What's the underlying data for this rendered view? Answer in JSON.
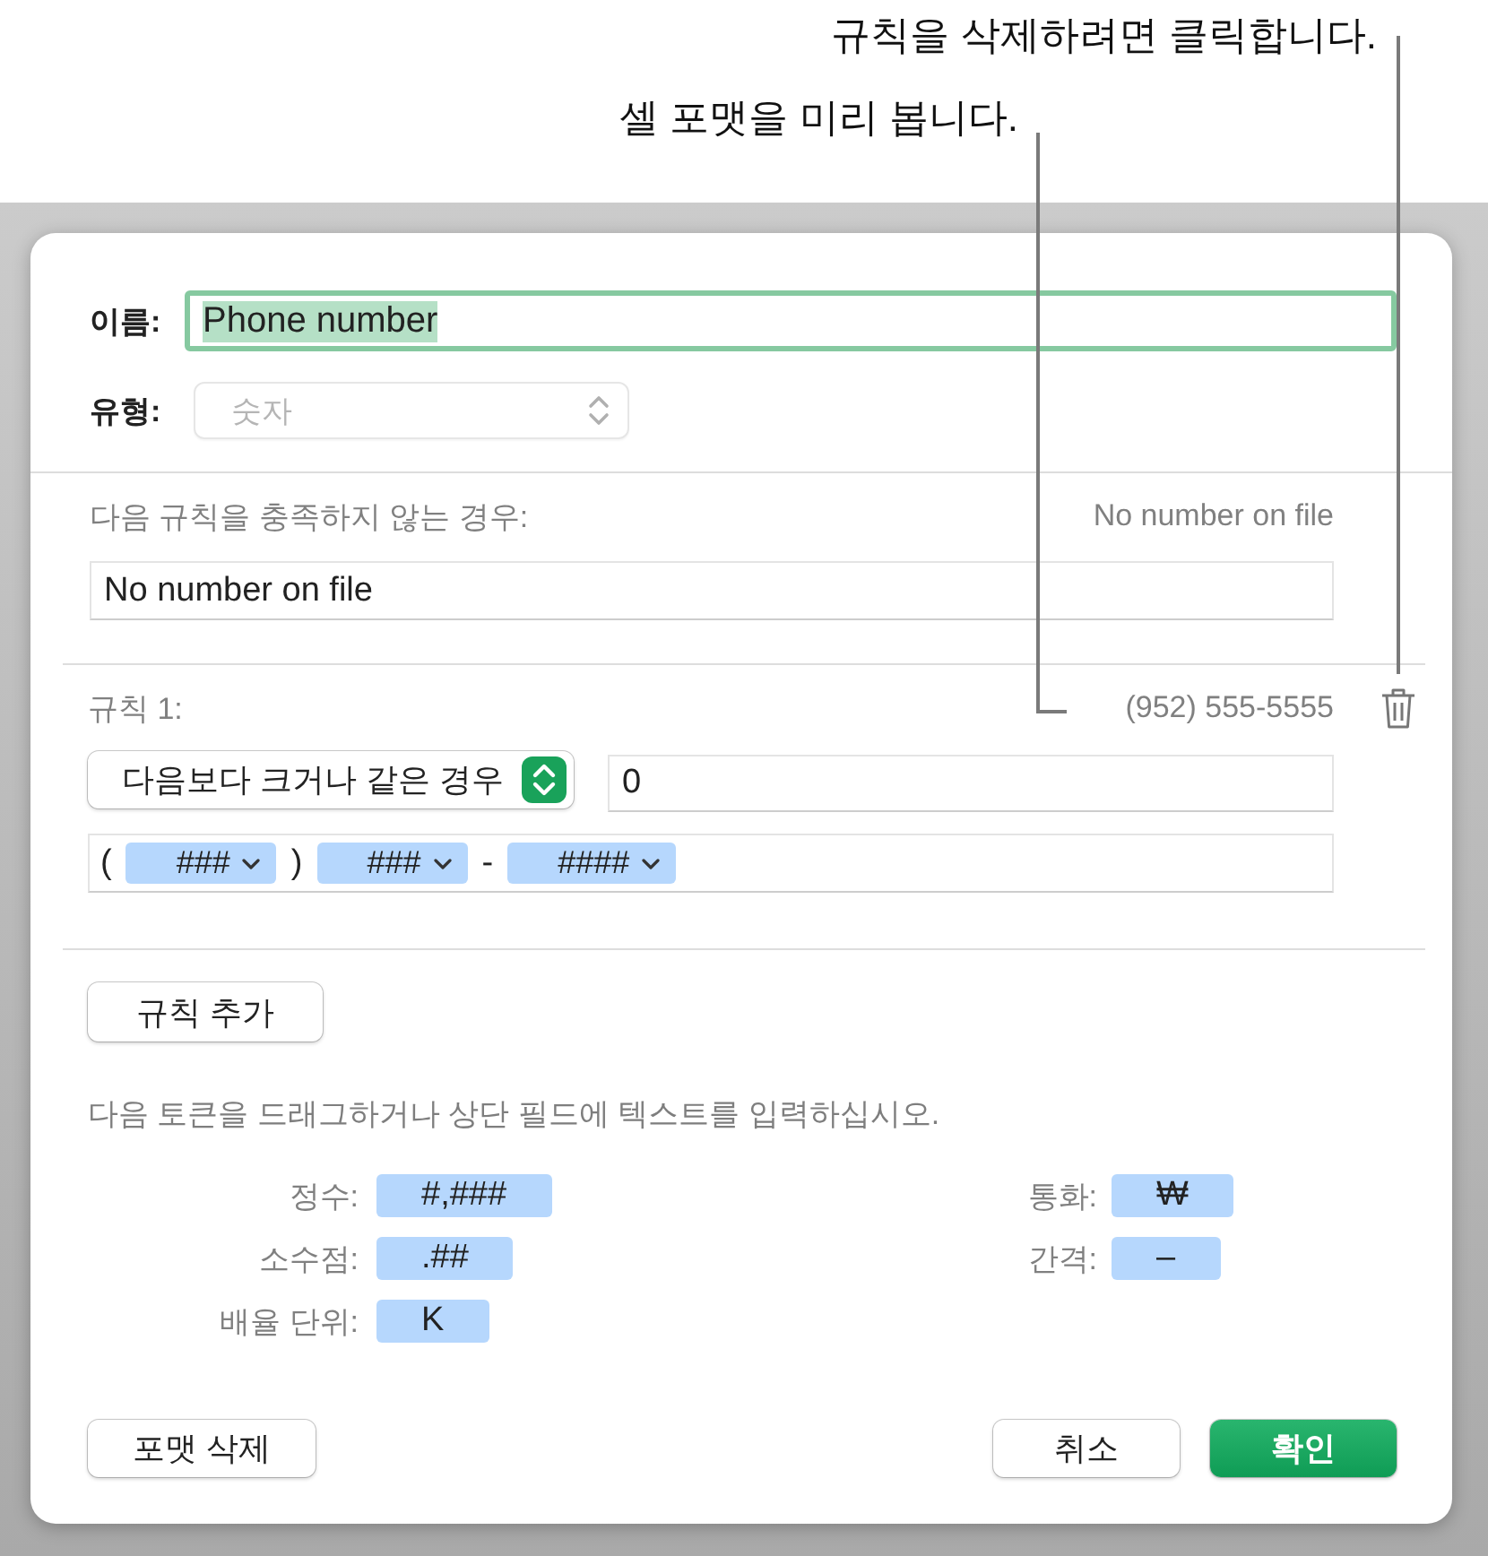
{
  "callouts": [
    {
      "text": "규칙을 삭제하려면 클릭합니다."
    },
    {
      "text": "셀 포맷을 미리 봅니다."
    }
  ],
  "name": {
    "label": "이름:",
    "value": "Phone number",
    "focused": true,
    "text_selected": true
  },
  "type": {
    "label": "유형:",
    "value": "숫자",
    "disabled": true
  },
  "fallback": {
    "label": "다음 규칙을 충족하지 않는 경우:",
    "preview": "No number on file",
    "value": "No number on file"
  },
  "rules": [
    {
      "label": "규칙 1:",
      "preview": "(952) 555-5555",
      "condition": "다음보다 크거나 같은 경우",
      "threshold": "0",
      "format": [
        {
          "kind": "text",
          "text": "("
        },
        {
          "kind": "token",
          "text": "###"
        },
        {
          "kind": "text",
          "text": ")"
        },
        {
          "kind": "token",
          "text": "###"
        },
        {
          "kind": "text",
          "text": "-"
        },
        {
          "kind": "token",
          "text": "####"
        }
      ]
    }
  ],
  "add_rule_button": "규칙 추가",
  "instructions": "다음 토큰을 드래그하거나 상단 필드에 텍스트를 입력하십시오.",
  "token_groups": [
    [
      {
        "label": "정수:",
        "token": "#,###"
      },
      {
        "label": "소수점:",
        "token": ".##"
      },
      {
        "label": "배율 단위:",
        "token": "K"
      }
    ],
    [
      {
        "label": "통화:",
        "token": "₩"
      },
      {
        "label": "간격:",
        "token": "–"
      }
    ]
  ],
  "footer": {
    "left": [
      {
        "label": "포맷 삭제",
        "kind": "plain"
      }
    ],
    "right": [
      {
        "label": "취소",
        "kind": "plain"
      },
      {
        "label": "확인",
        "kind": "default"
      }
    ]
  }
}
